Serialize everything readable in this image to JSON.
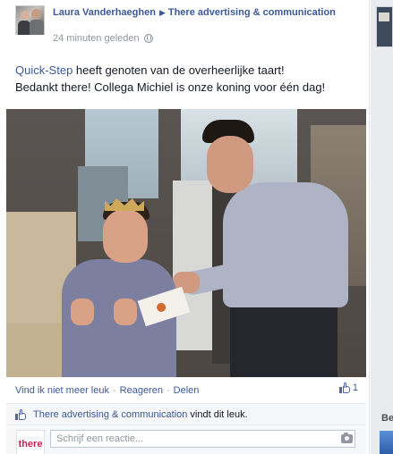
{
  "post": {
    "author": "Laura Vanderhaeghen",
    "target_page": "There advertising & communication",
    "timestamp": "24 minuten geleden",
    "audience_icon": "globe-icon",
    "caption": {
      "mention": "Quick-Step",
      "text_after_mention": " heeft genoten van de overheerlijke taart!",
      "line2": "Bedankt there! Collega Michiel is onze koning voor één dag!"
    },
    "actions": {
      "unlike": "Vind ik niet meer leuk",
      "comment": "Reageren",
      "share": "Delen",
      "separator": "·",
      "like_count": "1"
    },
    "likes_summary": {
      "liker": "There advertising & communication",
      "suffix": "vindt dit leuk."
    },
    "comment_box": {
      "avatar_text": "there",
      "placeholder": "Schrijf een reactie..."
    }
  },
  "sidebar": {
    "label": "Be"
  },
  "colors": {
    "link": "#3b5998",
    "muted": "#90949c",
    "brand_there": "#d31d55"
  }
}
